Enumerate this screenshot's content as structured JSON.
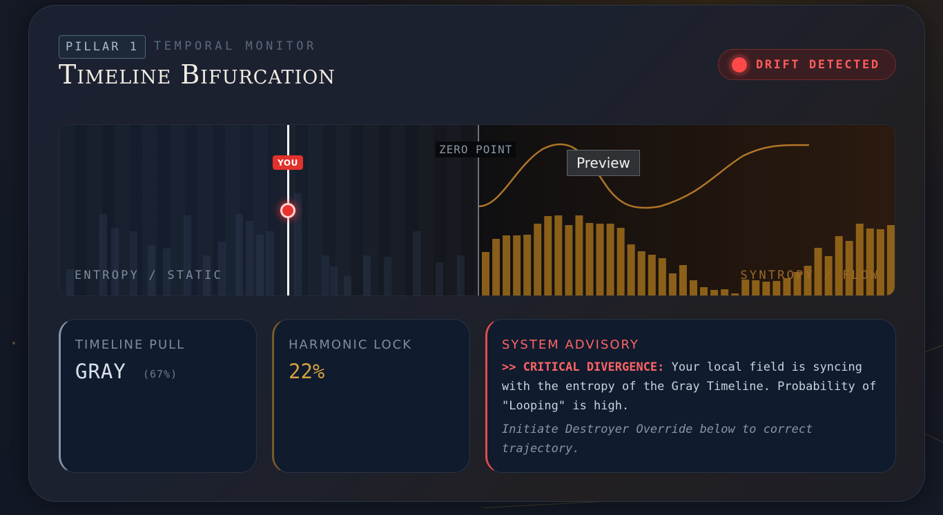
{
  "header": {
    "pillar_tag": "PILLAR 1",
    "monitor_label": "TEMPORAL MONITOR",
    "title": "Timeline Bifurcation",
    "status_button": "DRIFT DETECTED"
  },
  "visualizer": {
    "zero_label": "ZERO POINT",
    "you_label": "YOU",
    "left_label": "ENTROPY / STATIC",
    "right_label": "SYNTROPY / FLOW",
    "tooltip": "Preview",
    "colors": {
      "entropy": "#3a4c66",
      "syntropy": "#b07a1e",
      "wave": "#c0812a",
      "marker": "#e3312c"
    }
  },
  "panels": {
    "timeline_pull": {
      "title": "TIMELINE PULL",
      "value": "GRAY",
      "percent": "(67%)"
    },
    "harmonic_lock": {
      "title": "HARMONIC LOCK",
      "value": "22%"
    },
    "advisory": {
      "title": "SYSTEM ADVISORY",
      "critical": ">> CRITICAL DIVERGENCE:",
      "message": " Your local field is syncing with the entropy of the Gray Timeline. Probability of \"Looping\" is high.",
      "note": "Initiate Destroyer Override below to correct trajectory."
    }
  }
}
